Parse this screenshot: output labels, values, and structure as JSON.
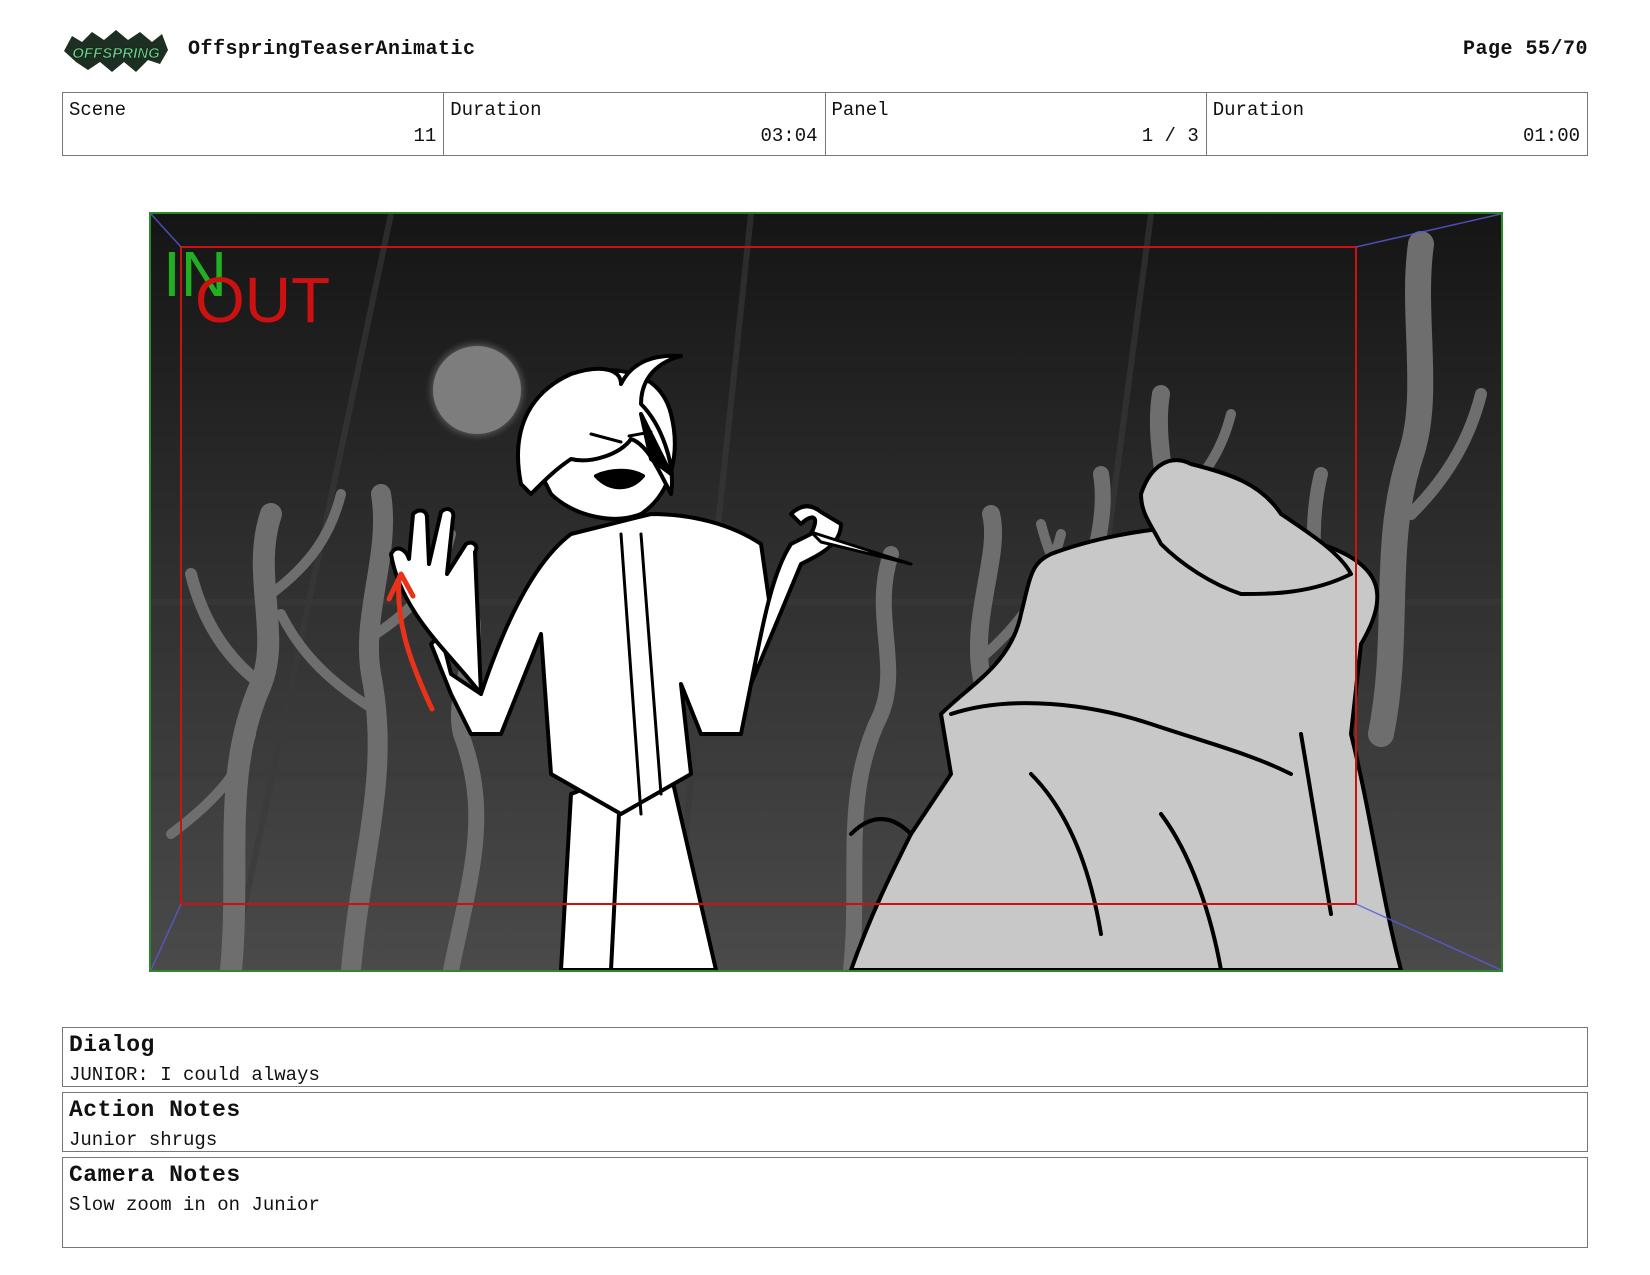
{
  "header": {
    "logo_text": "OFFSPRING",
    "project_title": "OffspringTeaserAnimatic",
    "page_number": "Page 55/70"
  },
  "info": {
    "scene_label": "Scene",
    "scene_value": "11",
    "scene_duration_label": "Duration",
    "scene_duration_value": "03:04",
    "panel_label": "Panel",
    "panel_value": "1 / 3",
    "panel_duration_label": "Duration",
    "panel_duration_value": "01:00"
  },
  "panel": {
    "in_label": "IN",
    "out_label": "OUT",
    "colors": {
      "in": "#22b022",
      "out": "#cc1111",
      "arrow": "#e8321a",
      "frame": "#2a8a2a"
    }
  },
  "notes": {
    "dialog_title": "Dialog",
    "dialog_text": "JUNIOR: I could always",
    "action_title": "Action Notes",
    "action_text": "Junior shrugs",
    "camera_title": "Camera Notes",
    "camera_text": "Slow zoom in on Junior"
  }
}
